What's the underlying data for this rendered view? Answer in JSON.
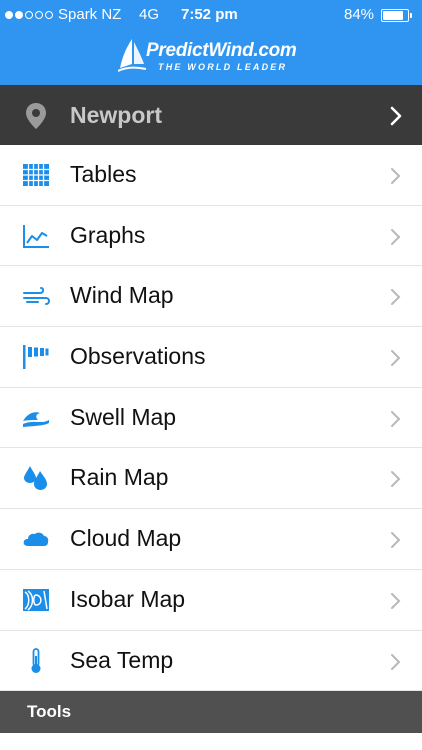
{
  "status_bar": {
    "carrier": "Spark NZ",
    "network": "4G",
    "time": "7:52 pm",
    "battery": "84%",
    "battery_level": 0.84,
    "signal_bars_filled": 2,
    "signal_bars_total": 5
  },
  "header": {
    "logo_name": "PredictWind.com",
    "logo_tagline": "THE WORLD LEADER",
    "background_color": "#2f95f0"
  },
  "location": {
    "icon": "location-pin-icon",
    "name": "Newport"
  },
  "menu": {
    "accent_color": "#1a8ee8",
    "items": [
      {
        "label": "Tables",
        "icon": "table-grid-icon"
      },
      {
        "label": "Graphs",
        "icon": "line-graph-icon"
      },
      {
        "label": "Wind Map",
        "icon": "wind-icon"
      },
      {
        "label": "Observations",
        "icon": "wind-flag-icon"
      },
      {
        "label": "Swell Map",
        "icon": "wave-icon"
      },
      {
        "label": "Rain Map",
        "icon": "raindrop-icon"
      },
      {
        "label": "Cloud Map",
        "icon": "cloud-icon"
      },
      {
        "label": "Isobar Map",
        "icon": "isobar-icon"
      },
      {
        "label": "Sea Temp",
        "icon": "thermometer-icon"
      }
    ]
  },
  "section": {
    "tools_label": "Tools"
  }
}
